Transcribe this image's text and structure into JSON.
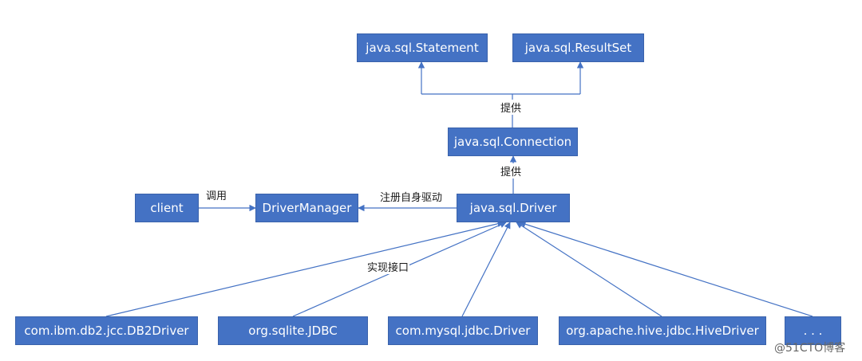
{
  "nodes": {
    "statement": "java.sql.Statement",
    "resultset": "java.sql.ResultSet",
    "connection": "java.sql.Connection",
    "driver": "java.sql.Driver",
    "driver_manager": "DriverManager",
    "client": "client",
    "db2_driver": "com.ibm.db2.jcc.DB2Driver",
    "sqlite_jdbc": "org.sqlite.JDBC",
    "mysql_driver": "com.mysql.jdbc.Driver",
    "hive_driver": "org.apache.hive.jdbc.HiveDriver",
    "ellipsis": ". . ."
  },
  "edge_labels": {
    "provide_top": "提供",
    "provide_mid": "提供",
    "call": "调用",
    "register": "注册自身驱动",
    "implements": "实现接口"
  },
  "watermark": "@51CTO博客",
  "colors": {
    "box_fill": "#4472c4",
    "box_text": "#ffffff",
    "line": "#4472c4"
  }
}
